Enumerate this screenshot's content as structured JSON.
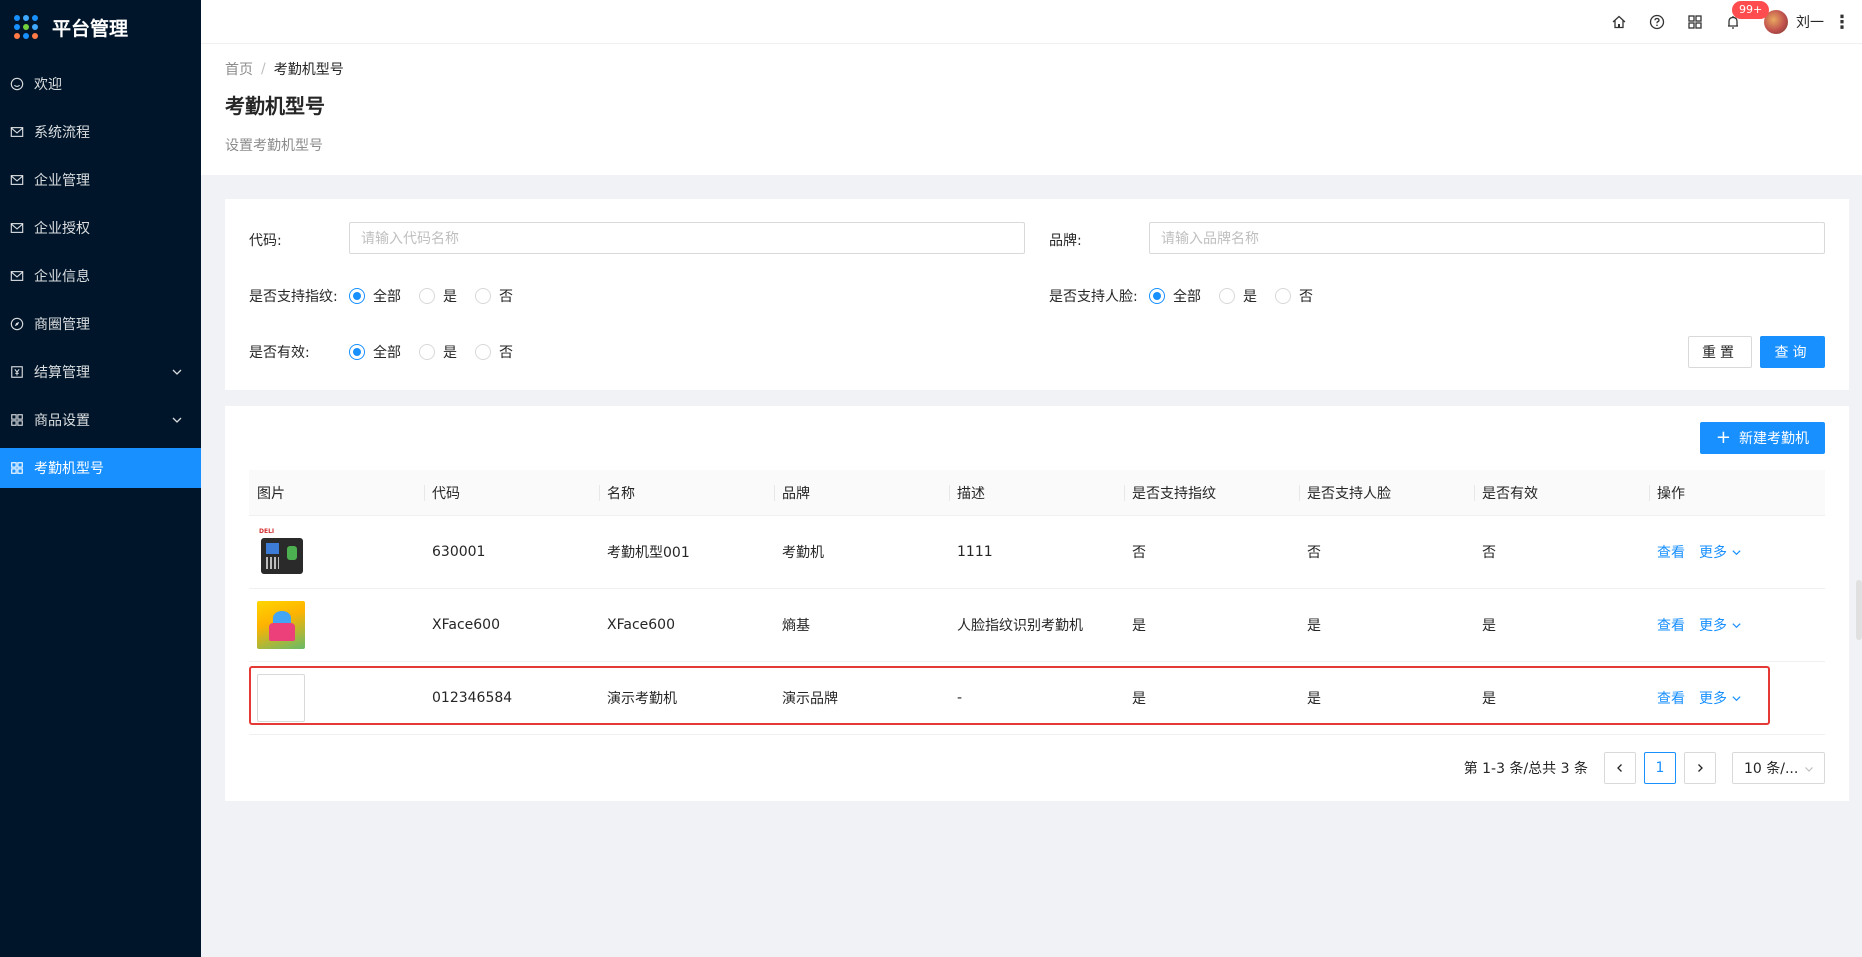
{
  "app": {
    "title": "平台管理"
  },
  "sidebar": {
    "items": [
      {
        "label": "欢迎",
        "icon": "smile-icon"
      },
      {
        "label": "系统流程",
        "icon": "mail-icon"
      },
      {
        "label": "企业管理",
        "icon": "mail-icon"
      },
      {
        "label": "企业授权",
        "icon": "mail-icon"
      },
      {
        "label": "企业信息",
        "icon": "mail-icon"
      },
      {
        "label": "商圈管理",
        "icon": "compass-icon"
      },
      {
        "label": "结算管理",
        "icon": "account-book-icon",
        "expandable": true
      },
      {
        "label": "商品设置",
        "icon": "appstore-icon",
        "expandable": true
      },
      {
        "label": "考勤机型号",
        "icon": "appstore-icon",
        "active": true
      }
    ]
  },
  "header": {
    "notification_count": "99+",
    "user_name": "刘一"
  },
  "breadcrumb": {
    "home": "首页",
    "current": "考勤机型号"
  },
  "page": {
    "title": "考勤机型号",
    "description": "设置考勤机型号"
  },
  "search": {
    "code_label": "代码:",
    "code_placeholder": "请输入代码名称",
    "brand_label": "品牌:",
    "brand_placeholder": "请输入品牌名称",
    "fingerprint_label": "是否支持指纹:",
    "face_label": "是否支持人脸:",
    "valid_label": "是否有效:",
    "options": {
      "all": "全部",
      "yes": "是",
      "no": "否"
    },
    "selected": "全部",
    "reset_label": "重置",
    "query_label": "查询"
  },
  "table": {
    "new_label": "新建考勤机",
    "columns": [
      "图片",
      "代码",
      "名称",
      "品牌",
      "描述",
      "是否支持指纹",
      "是否支持人脸",
      "是否有效",
      "操作"
    ],
    "rows": [
      {
        "code": "630001",
        "name": "考勤机型001",
        "brand": "考勤机",
        "description": "1111",
        "fingerprint": "否",
        "face": "否",
        "valid": "否"
      },
      {
        "code": "XFace600",
        "name": "XFace600",
        "brand": "熵基",
        "description": "人脸指纹识别考勤机",
        "fingerprint": "是",
        "face": "是",
        "valid": "是"
      },
      {
        "code": "012346584",
        "name": "演示考勤机",
        "brand": "演示品牌",
        "description": "-",
        "fingerprint": "是",
        "face": "是",
        "valid": "是"
      }
    ],
    "view_label": "查看",
    "more_label": "更多"
  },
  "pagination": {
    "total_text": "第 1-3 条/总共 3 条",
    "current_page": "1",
    "page_size": "10 条/..."
  },
  "colors": {
    "primary": "#1890ff",
    "sider": "#001529",
    "highlight": "#e53935",
    "badge": "#ff4d4f"
  }
}
